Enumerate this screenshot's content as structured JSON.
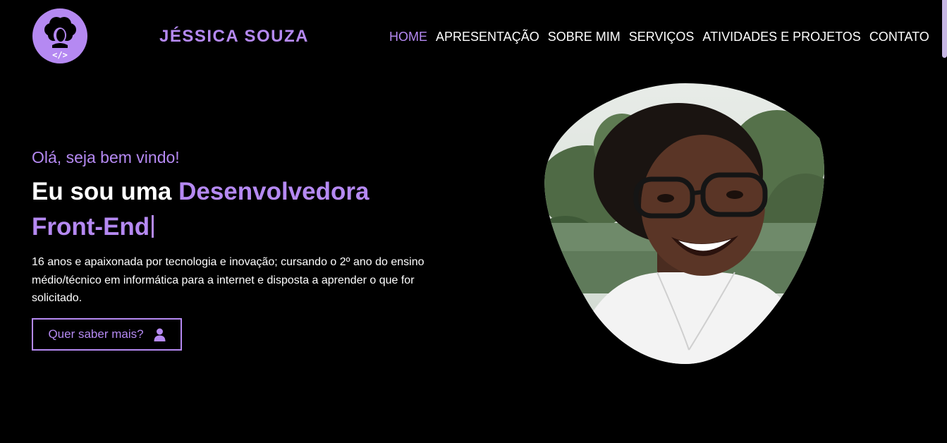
{
  "header": {
    "logo_icon": "afro-girl-code-logo-icon",
    "brand_name": "JÉSSICA SOUZA",
    "nav": [
      {
        "label": "HOME",
        "active": true
      },
      {
        "label": "APRESENTAÇÃO",
        "active": false
      },
      {
        "label": "SOBRE MIM",
        "active": false
      },
      {
        "label": "SERVIÇOS",
        "active": false
      },
      {
        "label": "ATIVIDADES E PROJETOS",
        "active": false
      },
      {
        "label": "CONTATO",
        "active": false
      }
    ]
  },
  "hero": {
    "greeting": "Olá, seja bem vindo!",
    "headline_prefix": "Eu sou uma ",
    "headline_accent_1": "Desenvolvedora",
    "headline_accent_2": "Front-End",
    "description": "16 anos e apaixonada por tecnologia e inovação; cursando o 2º ano do ensino médio/técnico em informática para a internet e disposta a aprender o que for solicitado.",
    "cta_label": "Quer saber mais?",
    "cta_icon": "user-icon",
    "portrait_icon": "profile-photo"
  },
  "colors": {
    "background": "#000000",
    "accent": "#b589f2",
    "text": "#ffffff"
  }
}
